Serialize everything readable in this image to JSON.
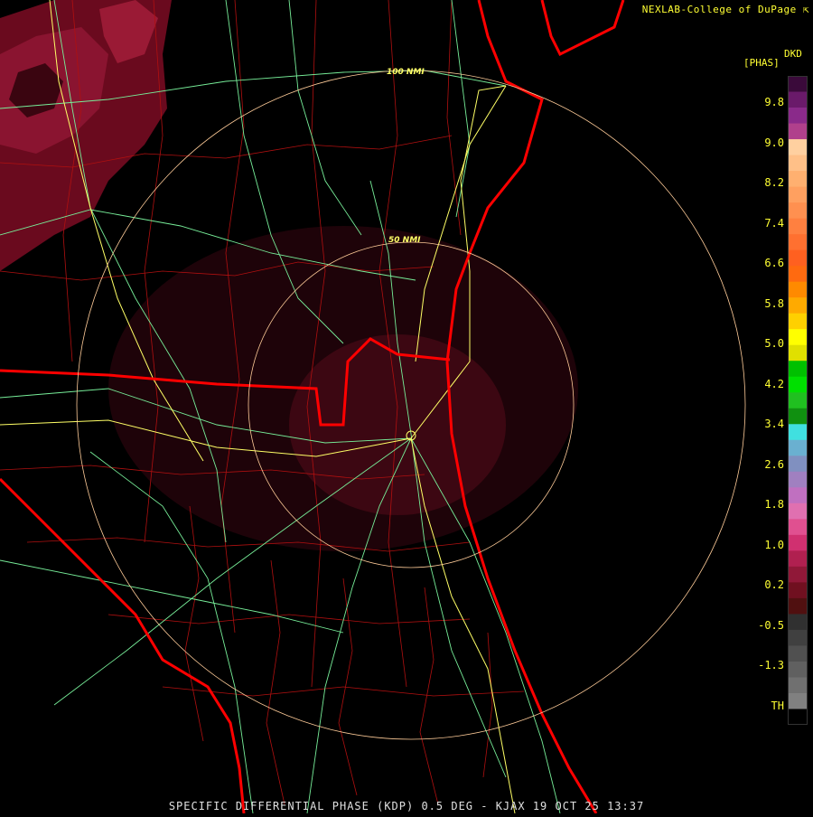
{
  "header": {
    "credit": "NEXLAB-College of DuPage",
    "credit_mark": "⇱",
    "product_code": "DKD",
    "unit_label": "[PHAS]"
  },
  "footer": {
    "caption": "SPECIFIC DIFFERENTIAL PHASE (KDP) 0.5 DEG - KJAX 19 OCT 25 13:37"
  },
  "range_rings": [
    {
      "label": "50 NMI"
    },
    {
      "label": "100 NMI"
    }
  ],
  "color_scale": {
    "labels": [
      "9.8",
      "9.0",
      "8.2",
      "7.4",
      "6.6",
      "5.8",
      "5.0",
      "4.2",
      "3.4",
      "2.6",
      "1.8",
      "1.0",
      "0.2",
      "-0.5",
      "-1.3",
      "TH"
    ],
    "colors": [
      "#3a0a3a",
      "#6a1a6a",
      "#8a2a8a",
      "#b0408c",
      "#ffd0a0",
      "#ffc088",
      "#ffb070",
      "#ffa060",
      "#ff9050",
      "#ff8040",
      "#ff7030",
      "#ff6020",
      "#ff6a10",
      "#ff8a00",
      "#ffaa00",
      "#ffd000",
      "#ffff00",
      "#e0e000",
      "#00c000",
      "#00e000",
      "#20c020",
      "#109010",
      "#40e0e0",
      "#6ab0d0",
      "#8090c0",
      "#a080c0",
      "#c070c0",
      "#e070b0",
      "#e05090",
      "#d03070",
      "#b02050",
      "#901838",
      "#701020",
      "#501010",
      "#303030",
      "#404040",
      "#505050",
      "#606060",
      "#707070",
      "#808080",
      "#000000"
    ]
  },
  "map_colors": {
    "coastline": "#ff0000",
    "county_lines": "#b01010",
    "highways": "#ffff66",
    "roads": "#77ee99",
    "range_rings": "#ffcc99",
    "echo_dark": "#6a0a1e",
    "echo_light": "#9a1a35"
  }
}
